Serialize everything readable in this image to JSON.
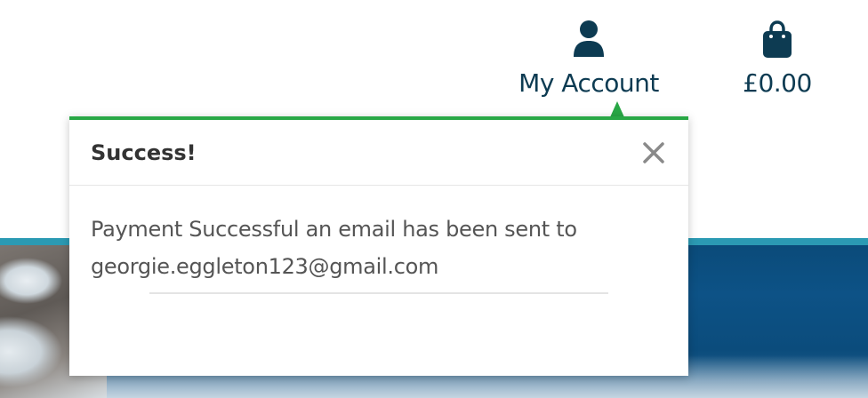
{
  "header": {
    "account": {
      "icon": "user-icon",
      "label": "My Account"
    },
    "cart": {
      "icon": "shopping-bag-icon",
      "label": "£0.00"
    }
  },
  "toast": {
    "accent_color": "#28a745",
    "title": "Success!",
    "close_icon": "close-icon",
    "message_line1": "Payment Successful an email has been sent to",
    "message_line2": "georgie.eggleton123@gmail.com"
  },
  "colors": {
    "nav_text": "#0d3b52",
    "hero_band": "#2b9ab3",
    "hero_blue": "#0d5286"
  }
}
